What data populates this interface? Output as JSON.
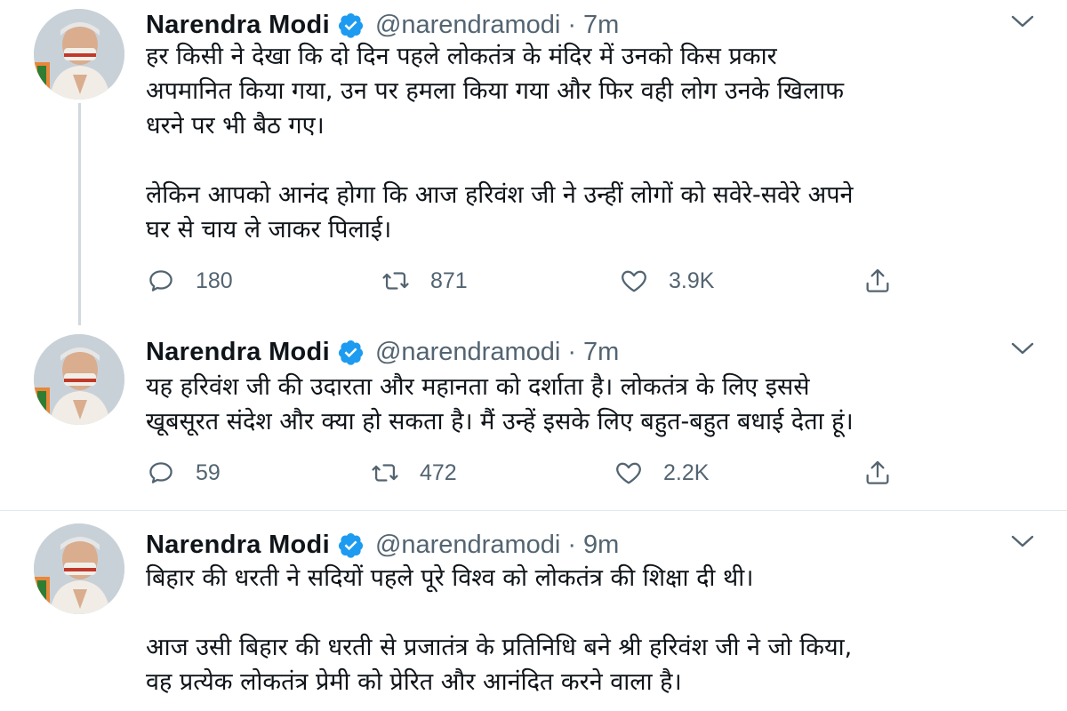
{
  "tweets": [
    {
      "name": "Narendra Modi",
      "handle": "@narendramodi",
      "separator": "·",
      "time": "7m",
      "text": "हर किसी ने देखा कि दो दिन पहले लोकतंत्र के मंदिर में उनको किस प्रकार\nअपमानित किया गया, उन पर हमला किया गया और फिर वही लोग उनके खिलाफ\nधरने पर भी बैठ गए।\n\nलेकिन आपको आनंद होगा कि आज हरिवंश जी ने उन्हीं लोगों को सवेरे-सवेरे अपने\nघर से चाय ले जाकर पिलाई।",
      "replies": "180",
      "retweets": "871",
      "likes": "3.9K"
    },
    {
      "name": "Narendra Modi",
      "handle": "@narendramodi",
      "separator": "·",
      "time": "7m",
      "text": "यह हरिवंश जी की उदारता और महानता को दर्शाता है। लोकतंत्र के लिए इससे\nखूबसूरत संदेश और क्या हो सकता है। मैं उन्हें इसके लिए बहुत-बहुत बधाई देता हूं।",
      "replies": "59",
      "retweets": "472",
      "likes": "2.2K"
    },
    {
      "name": "Narendra Modi",
      "handle": "@narendramodi",
      "separator": "·",
      "time": "9m",
      "text": "बिहार की धरती ने सदियों पहले पूरे विश्व को लोकतंत्र की शिक्षा दी थी।\n\nआज उसी बिहार की धरती से प्रजातंत्र के प्रतिनिधि बने श्री हरिवंश जी ने जो किया,\nवह प्रत्येक लोकतंत्र प्रेमी को प्रेरित और आनंदित करने वाला है।"
    }
  ],
  "icons": {
    "verified": "verified-badge-icon",
    "more": "chevron-down-icon",
    "reply": "reply-icon",
    "retweet": "retweet-icon",
    "like": "heart-icon",
    "share": "share-icon"
  },
  "colors": {
    "verified_blue": "#1d9bf0",
    "text": "#0f1419",
    "secondary": "#536471",
    "divider": "#e1e8ed",
    "thread_line": "#cfd9de"
  }
}
